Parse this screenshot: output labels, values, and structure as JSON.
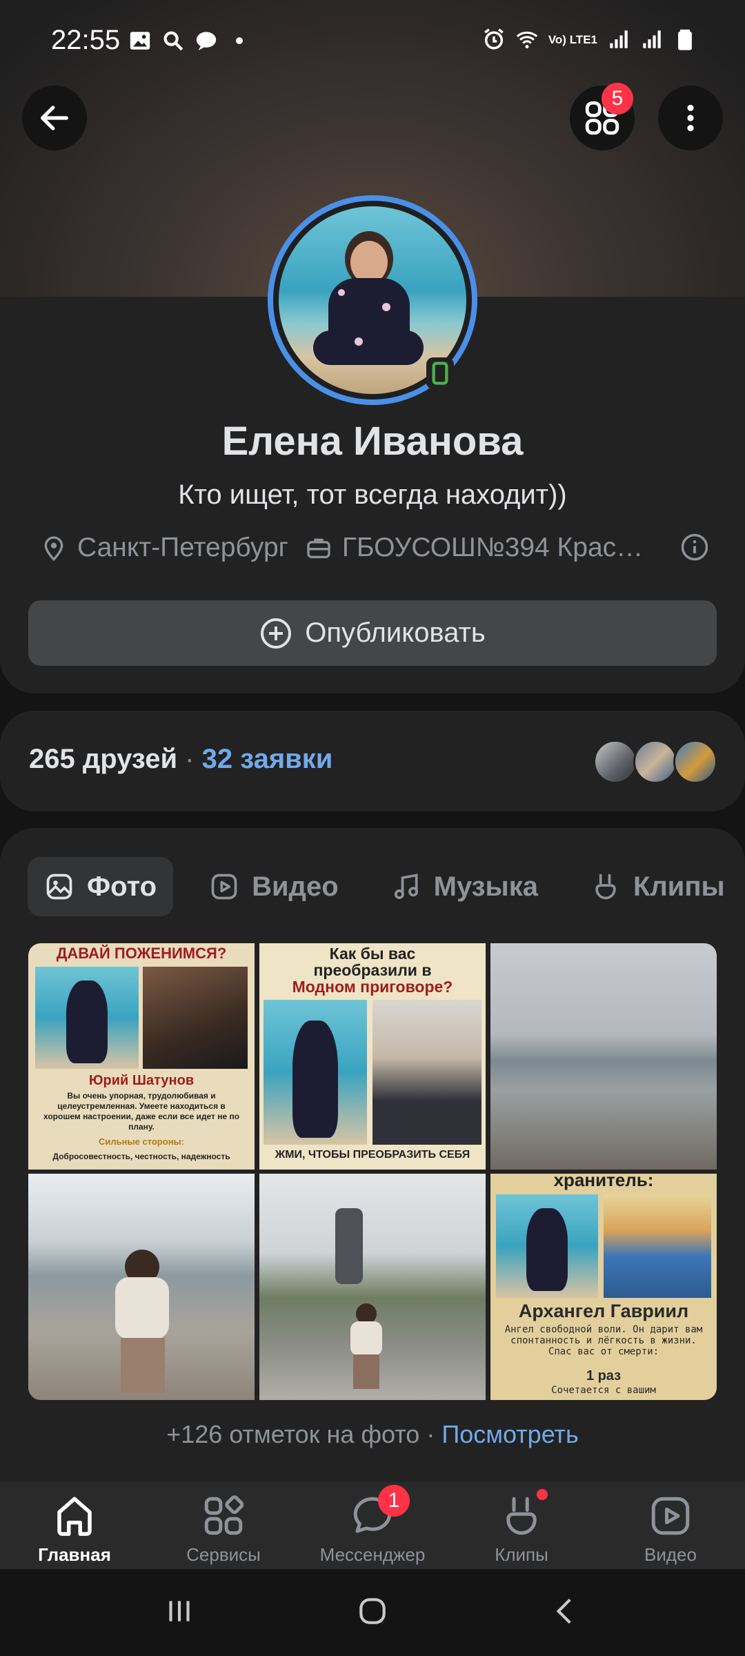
{
  "status_bar": {
    "time": "22:55",
    "network_label": "Vo) LTE1"
  },
  "header": {
    "apps_badge": "5"
  },
  "profile": {
    "name": "Елена Иванова",
    "status": "Кто ищет, тот всегда находит))",
    "city": "Санкт-Петербург",
    "work": "ГБОУСОШ№394 Крас…",
    "publish_label": "Опубликовать"
  },
  "friends": {
    "count_label": "265 друзей",
    "separator": " · ",
    "requests_label": "32 заявки"
  },
  "tabs": [
    {
      "label": "Фото",
      "icon": "photo-icon",
      "active": true
    },
    {
      "label": "Видео",
      "icon": "video-icon",
      "active": false
    },
    {
      "label": "Музыка",
      "icon": "music-icon",
      "active": false
    },
    {
      "label": "Клипы",
      "icon": "clips-icon",
      "active": false
    }
  ],
  "photos": {
    "p1": {
      "title": "ДАВАЙ ПОЖЕНИМСЯ?",
      "name": "Юрий Шатунов",
      "text": "Вы очень упорная, трудолюбивая и целеустремленная. Умеете находиться в хорошем настроении, даже если все идет не по плану.",
      "sub": "Сильные стороны:",
      "sub_text": "Добросовестность, честность, надежность"
    },
    "p2": {
      "title1": "Как бы вас",
      "title2": "преобразили в",
      "title3": "Модном приговоре?",
      "cta": "ЖМИ, ЧТОБЫ ПРЕОБРАЗИТЬ СЕБЯ"
    },
    "p6": {
      "title": "хранитель:",
      "name": "Архангел Гавриил",
      "text": "Ангел свободной воли. Он дарит вам спонтанность и лёгкость в жизни. Спас вас от смерти:",
      "times": "1 раз",
      "tail": "Сочетается с вашим"
    }
  },
  "tags": {
    "text": "+126 отметок на фото",
    "separator": " · ",
    "link": "Посмотреть"
  },
  "bottom_nav": [
    {
      "label": "Главная",
      "icon": "home-icon",
      "active": true
    },
    {
      "label": "Сервисы",
      "icon": "services-icon",
      "active": false
    },
    {
      "label": "Мессенджер",
      "icon": "messenger-icon",
      "active": false,
      "badge": "1"
    },
    {
      "label": "Клипы",
      "icon": "clips-icon",
      "active": false,
      "dot": true
    },
    {
      "label": "Видео",
      "icon": "video-icon",
      "active": false
    }
  ],
  "colors": {
    "accent": "#71aaeb",
    "ring": "#4a90e8",
    "badge": "#ff3347",
    "online": "#4bb34b"
  }
}
